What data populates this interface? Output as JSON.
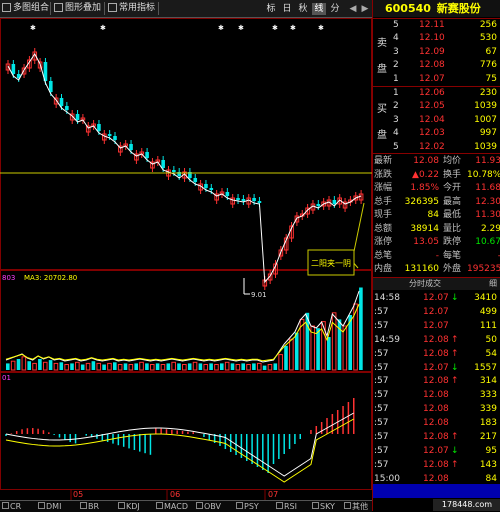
{
  "toolbar": {
    "items": [
      {
        "label": "多图组合"
      },
      {
        "label": "图形叠加"
      },
      {
        "label": "常用指标"
      }
    ],
    "period_tabs": [
      "标",
      "日",
      "秋",
      "线",
      "分"
    ],
    "active_period": 3
  },
  "chart": {
    "annotation_label": "二阳夹一阴",
    "low_price_label": "9.01",
    "volume_indicator": {
      "label": "803",
      "ma_label": "MA3: 20702.80"
    },
    "macd_indicator": {
      "label": "01"
    },
    "month_labels": [
      "05",
      "06",
      "07"
    ]
  },
  "bottom_tabs": [
    "CR",
    "DMI",
    "BR",
    "KDJ",
    "MACD",
    "OBV",
    "PSY",
    "RSI",
    "SKY",
    "其他"
  ],
  "panel": {
    "code": "600540",
    "name": "新赛股份",
    "sell_label": [
      "卖",
      "盘"
    ],
    "buy_label": [
      "买",
      "盘"
    ],
    "sell": [
      {
        "level": "5",
        "price": "12.11",
        "vol": "256"
      },
      {
        "level": "4",
        "price": "12.10",
        "vol": "530"
      },
      {
        "level": "3",
        "price": "12.09",
        "vol": "67"
      },
      {
        "level": "2",
        "price": "12.08",
        "vol": "776"
      },
      {
        "level": "1",
        "price": "12.07",
        "vol": "75"
      }
    ],
    "buy": [
      {
        "level": "1",
        "price": "12.06",
        "vol": "230"
      },
      {
        "level": "2",
        "price": "12.05",
        "vol": "1039"
      },
      {
        "level": "3",
        "price": "12.04",
        "vol": "1007"
      },
      {
        "level": "4",
        "price": "12.03",
        "vol": "997"
      },
      {
        "level": "5",
        "price": "12.02",
        "vol": "1039"
      }
    ],
    "stats": [
      {
        "l1": "最新",
        "v1": "12.08",
        "l2": "均价",
        "v2": "11.93"
      },
      {
        "l1": "涨跌",
        "v1": "▲0.22",
        "l2": "换手",
        "v2": "10.78%"
      },
      {
        "l1": "涨幅",
        "v1": "1.85%",
        "l2": "今开",
        "v2": "11.68"
      },
      {
        "l1": "总手",
        "v1": "326395",
        "l2": "最高",
        "v2": "12.30"
      },
      {
        "l1": "现手",
        "v1": "84",
        "l2": "最低",
        "v2": "11.30"
      },
      {
        "l1": "总额",
        "v1": "38914",
        "l2": "量比",
        "v2": "2.29"
      },
      {
        "l1": "涨停",
        "v1": "13.05",
        "l2": "跌停",
        "v2": "10.67"
      },
      {
        "l1": "总笔",
        "v1": "-",
        "l2": "每笔",
        "v2": "-"
      },
      {
        "l1": "内盘",
        "v1": "131160",
        "l2": "外盘",
        "v2": "195235"
      }
    ],
    "trades_header": {
      "title": "分时成交",
      "detail": "细"
    },
    "trades": [
      {
        "time": "14:58",
        "price": "12.07",
        "arrow": "↓",
        "vol": "3410",
        "c": "red"
      },
      {
        "time": ":57",
        "price": "12.07",
        "arrow": "",
        "vol": "499",
        "c": "red"
      },
      {
        "time": ":57",
        "price": "12.07",
        "arrow": "",
        "vol": "111",
        "c": "red"
      },
      {
        "time": "14:59",
        "price": "12.08",
        "arrow": "↑",
        "vol": "50",
        "c": "red"
      },
      {
        "time": ":57",
        "price": "12.08",
        "arrow": "↑",
        "vol": "54",
        "c": "red"
      },
      {
        "time": ":57",
        "price": "12.07",
        "arrow": "↓",
        "vol": "1557",
        "c": "red"
      },
      {
        "time": ":57",
        "price": "12.08",
        "arrow": "↑",
        "vol": "314",
        "c": "red"
      },
      {
        "time": ":57",
        "price": "12.08",
        "arrow": "",
        "vol": "333",
        "c": "red"
      },
      {
        "time": ":57",
        "price": "12.08",
        "arrow": "",
        "vol": "339",
        "c": "red"
      },
      {
        "time": ":57",
        "price": "12.08",
        "arrow": "",
        "vol": "183",
        "c": "red"
      },
      {
        "time": ":57",
        "price": "12.08",
        "arrow": "↑",
        "vol": "217",
        "c": "red"
      },
      {
        "time": ":57",
        "price": "12.07",
        "arrow": "↓",
        "vol": "95",
        "c": "red"
      },
      {
        "time": ":57",
        "price": "12.08",
        "arrow": "↑",
        "vol": "143",
        "c": "red"
      },
      {
        "time": "15:00",
        "price": "12.08",
        "arrow": "",
        "vol": "84",
        "c": "red"
      }
    ],
    "watermark": "178448.com"
  },
  "colors": {
    "up": "#ff3232",
    "down": "#00e6e6",
    "ma1": "#ffffff",
    "ma2": "#ffff00",
    "ma3": "#ff40ff",
    "ma4": "#00ff00",
    "grid": "#800000"
  }
}
